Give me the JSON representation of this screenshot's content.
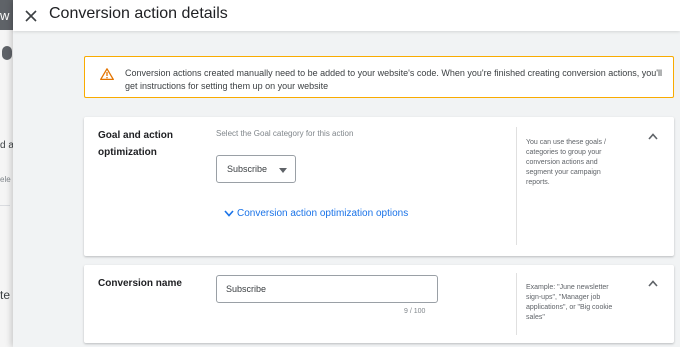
{
  "background": {
    "top_letter": "w",
    "fragments": [
      "d a",
      "ele",
      "te"
    ]
  },
  "panel": {
    "title": "Conversion action details"
  },
  "warning": {
    "text": "Conversion actions created manually need to be added to your website's code. When you're finished creating conversion actions, you'll get instructions for setting them up on your website"
  },
  "goal_section": {
    "label": "Goal and action optimization",
    "helper": "Select the Goal category for this action",
    "dropdown_value": "Subscribe",
    "options_link": "Conversion action optimization options",
    "side_note": "You can use these goals / categories to group your conversion actions and segment your campaign reports."
  },
  "name_section": {
    "label": "Conversion name",
    "input_value": "Subscribe",
    "char_count": "9 / 100",
    "side_note": "Example: \"June newsletter sign-ups\", \"Manager job applications\", or \"Big cookie sales\""
  },
  "icons": {
    "close": "close-icon",
    "warning": "warning-icon",
    "caret": "caret-down-icon",
    "chevron_down": "chevron-down-icon",
    "chevron_up": "chevron-up-icon"
  },
  "colors": {
    "accent": "#1a73e8",
    "warning_border": "#f9ab00",
    "warning_icon": "#e37400"
  }
}
